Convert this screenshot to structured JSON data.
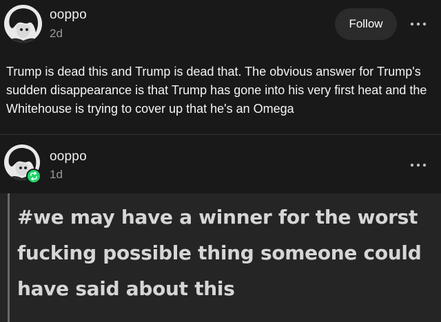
{
  "post1": {
    "username": "ooppo",
    "timestamp": "2d",
    "follow_label": "Follow",
    "more_icon": "ellipsis-icon",
    "avatar_icon": "avatar-image",
    "body": "Trump is dead this and Trump is dead that. The obvious answer for Trump's sudden disappearance is that Trump has gone into his very first heat and the Whitehouse is trying to cover up that he's an Omega"
  },
  "post2": {
    "username": "ooppo",
    "timestamp": "1d",
    "more_icon": "ellipsis-icon",
    "avatar_icon": "avatar-image",
    "reblog_icon": "reblog-icon",
    "reblog_color": "#1fd66b",
    "tag_text": "#we may have a winner for the worst fucking possible thing someone could have said about this"
  },
  "colors": {
    "background": "#191919",
    "quote_background": "#252525",
    "follow_button_background": "#2b2b2b",
    "timestamp": "#9a9a9a"
  }
}
